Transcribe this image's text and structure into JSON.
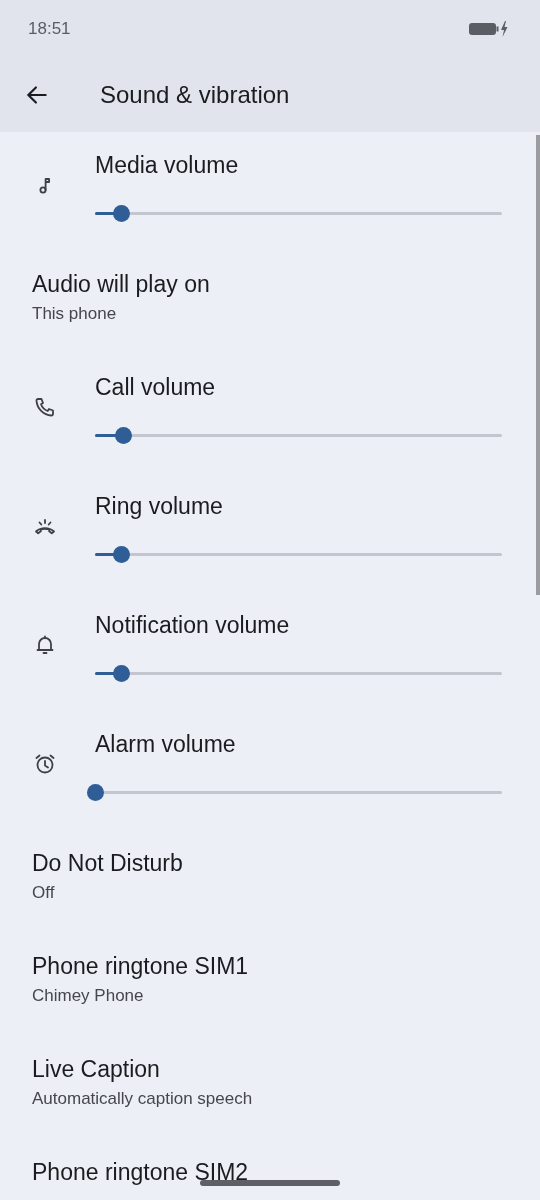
{
  "status_bar": {
    "time": "18:51"
  },
  "app_bar": {
    "title": "Sound & vibration"
  },
  "items": [
    {
      "kind": "slider",
      "title": "Media volume",
      "level": 0.064
    },
    {
      "kind": "text",
      "title": "Audio will play on",
      "subtitle": "This phone"
    },
    {
      "kind": "slider",
      "title": "Call volume",
      "level": 0.071
    },
    {
      "kind": "slider",
      "title": "Ring volume",
      "level": 0.064
    },
    {
      "kind": "slider",
      "title": "Notification volume",
      "level": 0.064
    },
    {
      "kind": "slider",
      "title": "Alarm volume",
      "level": 0
    },
    {
      "kind": "text",
      "title": "Do Not Disturb",
      "subtitle": "Off"
    },
    {
      "kind": "text",
      "title": "Phone ringtone SIM1",
      "subtitle": "Chimey Phone"
    },
    {
      "kind": "text",
      "title": "Live Caption",
      "subtitle": "Automatically caption speech"
    },
    {
      "kind": "text",
      "title": "Phone ringtone SIM2"
    }
  ]
}
